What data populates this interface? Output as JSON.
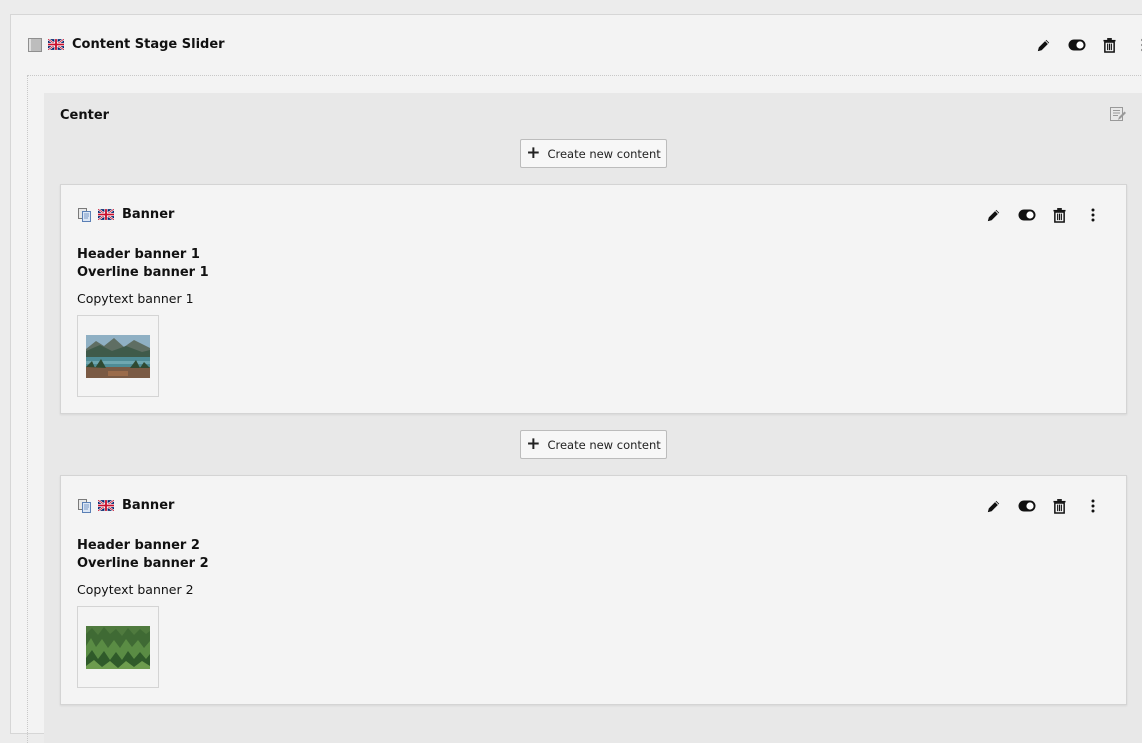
{
  "stage": {
    "title": "Content Stage Slider",
    "icons": {
      "type": "grey-box-icon",
      "language": "uk-flag-icon"
    },
    "actions": [
      "edit-icon",
      "toggle-icon",
      "delete-icon",
      "more-icon"
    ]
  },
  "column": {
    "title": "Center",
    "create_label": "Create new content",
    "create_icon": "+"
  },
  "banners": [
    {
      "type": "Banner",
      "header": "Header banner 1",
      "overline": "Overline banner 1",
      "copytext": "Copytext banner 1",
      "image": "mountain-lake-thumbnail"
    },
    {
      "type": "Banner",
      "header": "Header banner 2",
      "overline": "Overline banner 2",
      "copytext": "Copytext banner 2",
      "image": "forest-thumbnail"
    }
  ],
  "colors": {
    "page_bg": "#ececec",
    "card_bg": "#f4f4f4",
    "column_bg": "#e8e8e8",
    "border": "#d4d4d4"
  }
}
